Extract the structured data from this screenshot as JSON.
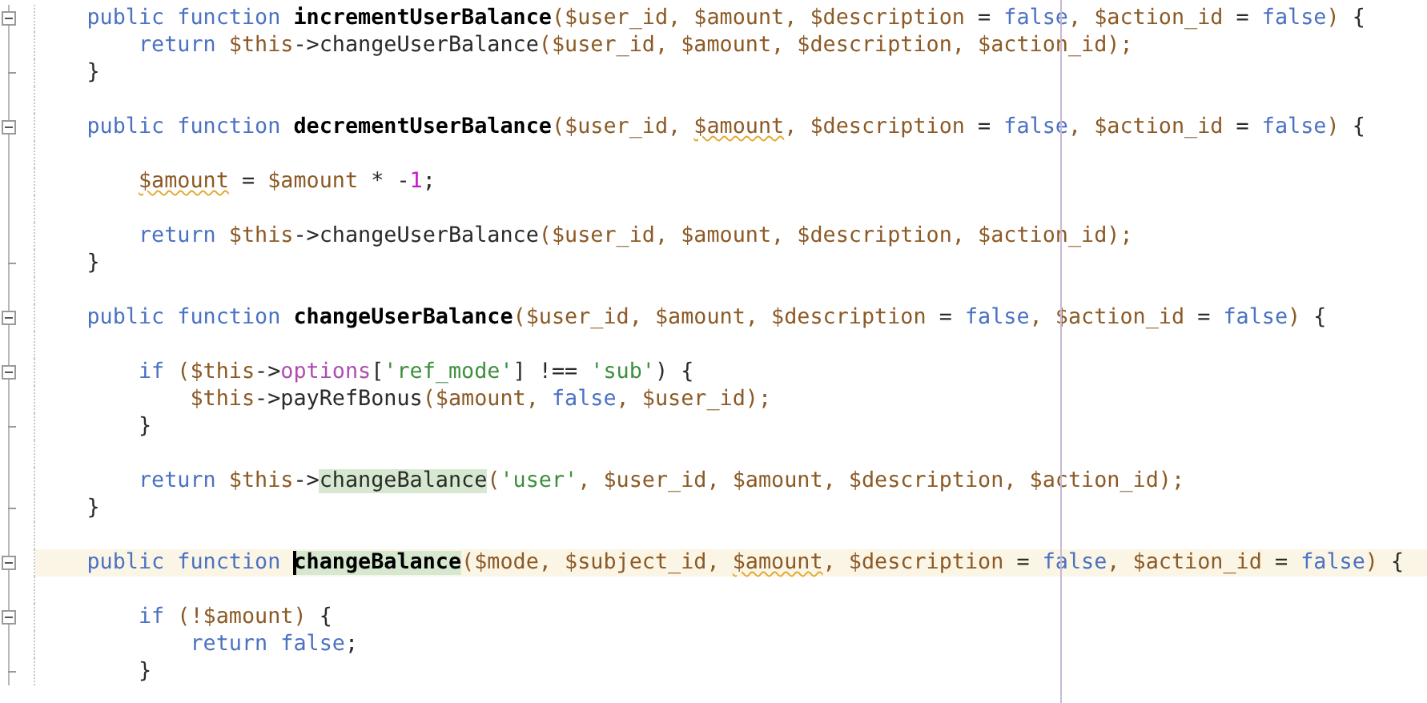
{
  "editor": {
    "lines": [
      {
        "kind": "code",
        "tokens": [
          {
            "t": "public function ",
            "kind": "keyword"
          },
          {
            "t": "incrementUserBalance",
            "kind": "function"
          },
          {
            "t": "($user_id, $amount, $description ",
            "kind": "variable"
          },
          {
            "t": "= ",
            "kind": "plain"
          },
          {
            "t": "false",
            "kind": "keyword"
          },
          {
            "t": ", $action_id ",
            "kind": "variable"
          },
          {
            "t": "= ",
            "kind": "plain"
          },
          {
            "t": "false",
            "kind": "keyword"
          },
          {
            "t": ") ",
            "kind": "variable"
          },
          {
            "t": "{",
            "kind": "plain"
          }
        ],
        "children": [
          {
            "kind": "code",
            "tokens": [
              {
                "t": "return ",
                "kind": "keyword"
              },
              {
                "t": "$this",
                "kind": "variable"
              },
              {
                "t": "->changeUserBalance",
                "kind": "plain"
              },
              {
                "t": "($user_id, $amount, $description, $action_id);",
                "kind": "variable"
              }
            ]
          }
        ]
      },
      {
        "kind": "code",
        "tokens": [
          {
            "t": "}",
            "kind": "plain"
          }
        ]
      },
      {
        "kind": "blank"
      },
      {
        "kind": "code",
        "tokens": [
          {
            "t": "public function ",
            "kind": "keyword"
          },
          {
            "t": "decrementUserBalance",
            "kind": "function"
          },
          {
            "t": "($user_id, ",
            "kind": "variable"
          },
          {
            "t": "$amount",
            "kind": "variable",
            "warning": true
          },
          {
            "t": ", $description ",
            "kind": "variable"
          },
          {
            "t": "= ",
            "kind": "plain"
          },
          {
            "t": "false",
            "kind": "keyword"
          },
          {
            "t": ", $action_id ",
            "kind": "variable"
          },
          {
            "t": "= ",
            "kind": "plain"
          },
          {
            "t": "false",
            "kind": "keyword"
          },
          {
            "t": ") ",
            "kind": "variable"
          },
          {
            "t": "{",
            "kind": "plain"
          }
        ],
        "children": [
          {
            "kind": "blank"
          },
          {
            "kind": "code",
            "tokens": [
              {
                "t": "$amount",
                "kind": "variable",
                "warning": true
              },
              {
                "t": " = ",
                "kind": "plain"
              },
              {
                "t": "$amount",
                "kind": "variable"
              },
              {
                "t": " * -",
                "kind": "plain"
              },
              {
                "t": "1",
                "kind": "number"
              },
              {
                "t": ";",
                "kind": "plain"
              }
            ]
          },
          {
            "kind": "blank"
          },
          {
            "kind": "code",
            "tokens": [
              {
                "t": "return ",
                "kind": "keyword"
              },
              {
                "t": "$this",
                "kind": "variable"
              },
              {
                "t": "->changeUserBalance",
                "kind": "plain"
              },
              {
                "t": "($user_id, $amount, $description, $action_id);",
                "kind": "variable"
              }
            ]
          }
        ]
      },
      {
        "kind": "code",
        "tokens": [
          {
            "t": "}",
            "kind": "plain"
          }
        ]
      },
      {
        "kind": "blank"
      },
      {
        "kind": "code",
        "tokens": [
          {
            "t": "public function ",
            "kind": "keyword"
          },
          {
            "t": "changeUserBalance",
            "kind": "function"
          },
          {
            "t": "($user_id, $amount, $description ",
            "kind": "variable"
          },
          {
            "t": "= ",
            "kind": "plain"
          },
          {
            "t": "false",
            "kind": "keyword"
          },
          {
            "t": ", $action_id ",
            "kind": "variable"
          },
          {
            "t": "= ",
            "kind": "plain"
          },
          {
            "t": "false",
            "kind": "keyword"
          },
          {
            "t": ") ",
            "kind": "variable"
          },
          {
            "t": "{",
            "kind": "plain"
          }
        ],
        "children": [
          {
            "kind": "blank"
          },
          {
            "kind": "code",
            "tokens": [
              {
                "t": "if ",
                "kind": "keyword"
              },
              {
                "t": "($this",
                "kind": "variable"
              },
              {
                "t": "->",
                "kind": "plain"
              },
              {
                "t": "options",
                "kind": "property"
              },
              {
                "t": "[",
                "kind": "plain"
              },
              {
                "t": "'ref_mode'",
                "kind": "string"
              },
              {
                "t": "] !== ",
                "kind": "plain"
              },
              {
                "t": "'sub'",
                "kind": "string"
              },
              {
                "t": ") {",
                "kind": "plain"
              }
            ],
            "children": [
              {
                "kind": "code",
                "tokens": [
                  {
                    "t": "$this",
                    "kind": "variable"
                  },
                  {
                    "t": "->payRefBonus",
                    "kind": "plain"
                  },
                  {
                    "t": "($amount, ",
                    "kind": "variable"
                  },
                  {
                    "t": "false",
                    "kind": "keyword"
                  },
                  {
                    "t": ", $user_id);",
                    "kind": "variable"
                  }
                ]
              }
            ]
          },
          {
            "kind": "code",
            "tokens": [
              {
                "t": "}",
                "kind": "plain"
              }
            ]
          },
          {
            "kind": "blank"
          },
          {
            "kind": "code",
            "tokens": [
              {
                "t": "return ",
                "kind": "keyword"
              },
              {
                "t": "$this",
                "kind": "variable"
              },
              {
                "t": "->",
                "kind": "plain"
              },
              {
                "t": "changeBalance",
                "kind": "plain",
                "highlighted": true
              },
              {
                "t": "(",
                "kind": "variable"
              },
              {
                "t": "'user'",
                "kind": "string"
              },
              {
                "t": ", $user_id, $amount, $description, $action_id);",
                "kind": "variable"
              }
            ]
          }
        ]
      },
      {
        "kind": "code",
        "tokens": [
          {
            "t": "}",
            "kind": "plain"
          }
        ]
      },
      {
        "kind": "blank"
      },
      {
        "kind": "code",
        "current": true,
        "tokens": [
          {
            "t": "public function ",
            "kind": "keyword"
          },
          {
            "t": "changeBalance",
            "kind": "function",
            "highlighted": true,
            "caret": true
          },
          {
            "t": "($mode, $subject_id, ",
            "kind": "variable"
          },
          {
            "t": "$amount",
            "kind": "variable",
            "warning": true
          },
          {
            "t": ", $description ",
            "kind": "variable"
          },
          {
            "t": "= ",
            "kind": "plain"
          },
          {
            "t": "false",
            "kind": "keyword"
          },
          {
            "t": ", $action_id ",
            "kind": "variable"
          },
          {
            "t": "= ",
            "kind": "plain"
          },
          {
            "t": "false",
            "kind": "keyword"
          },
          {
            "t": ") ",
            "kind": "variable"
          },
          {
            "t": "{",
            "kind": "plain"
          }
        ],
        "children": [
          {
            "kind": "blank"
          },
          {
            "kind": "code",
            "tokens": [
              {
                "t": "if ",
                "kind": "keyword"
              },
              {
                "t": "(!$amount) ",
                "kind": "variable"
              },
              {
                "t": "{",
                "kind": "plain"
              }
            ],
            "children": [
              {
                "kind": "code",
                "tokens": [
                  {
                    "t": "return false",
                    "kind": "keyword"
                  },
                  {
                    "t": ";",
                    "kind": "plain"
                  }
                ]
              }
            ]
          },
          {
            "kind": "code",
            "tokens": [
              {
                "t": "}",
                "kind": "plain"
              }
            ]
          }
        ]
      }
    ]
  }
}
